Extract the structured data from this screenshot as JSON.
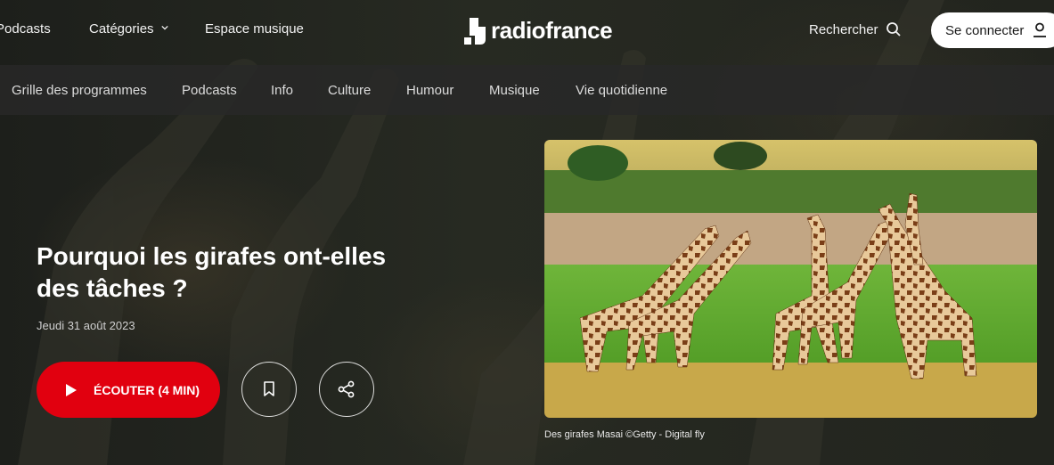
{
  "brand": {
    "logo_text": "radiofrance"
  },
  "top_nav": {
    "podcasts": "Podcasts",
    "categories": "Catégories",
    "music_space": "Espace musique",
    "search": "Rechercher",
    "login": "Se connecter"
  },
  "sub_nav": [
    "Grille des programmes",
    "Podcasts",
    "Info",
    "Culture",
    "Humour",
    "Musique",
    "Vie quotidienne"
  ],
  "article": {
    "title": "Pourquoi les girafes ont-elles des tâches ?",
    "date": "Jeudi 31 août 2023",
    "listen_label": "ÉCOUTER (4 MIN)",
    "image_caption": "Des girafes Masai ©Getty - Digital fly"
  },
  "icons": {
    "search": "search-icon",
    "user": "user-icon",
    "play": "play-icon",
    "bookmark": "bookmark-icon",
    "share": "share-icon",
    "chevron": "chevron-down-icon"
  },
  "colors": {
    "accent": "#e1000f",
    "nav_bg": "#282828"
  }
}
